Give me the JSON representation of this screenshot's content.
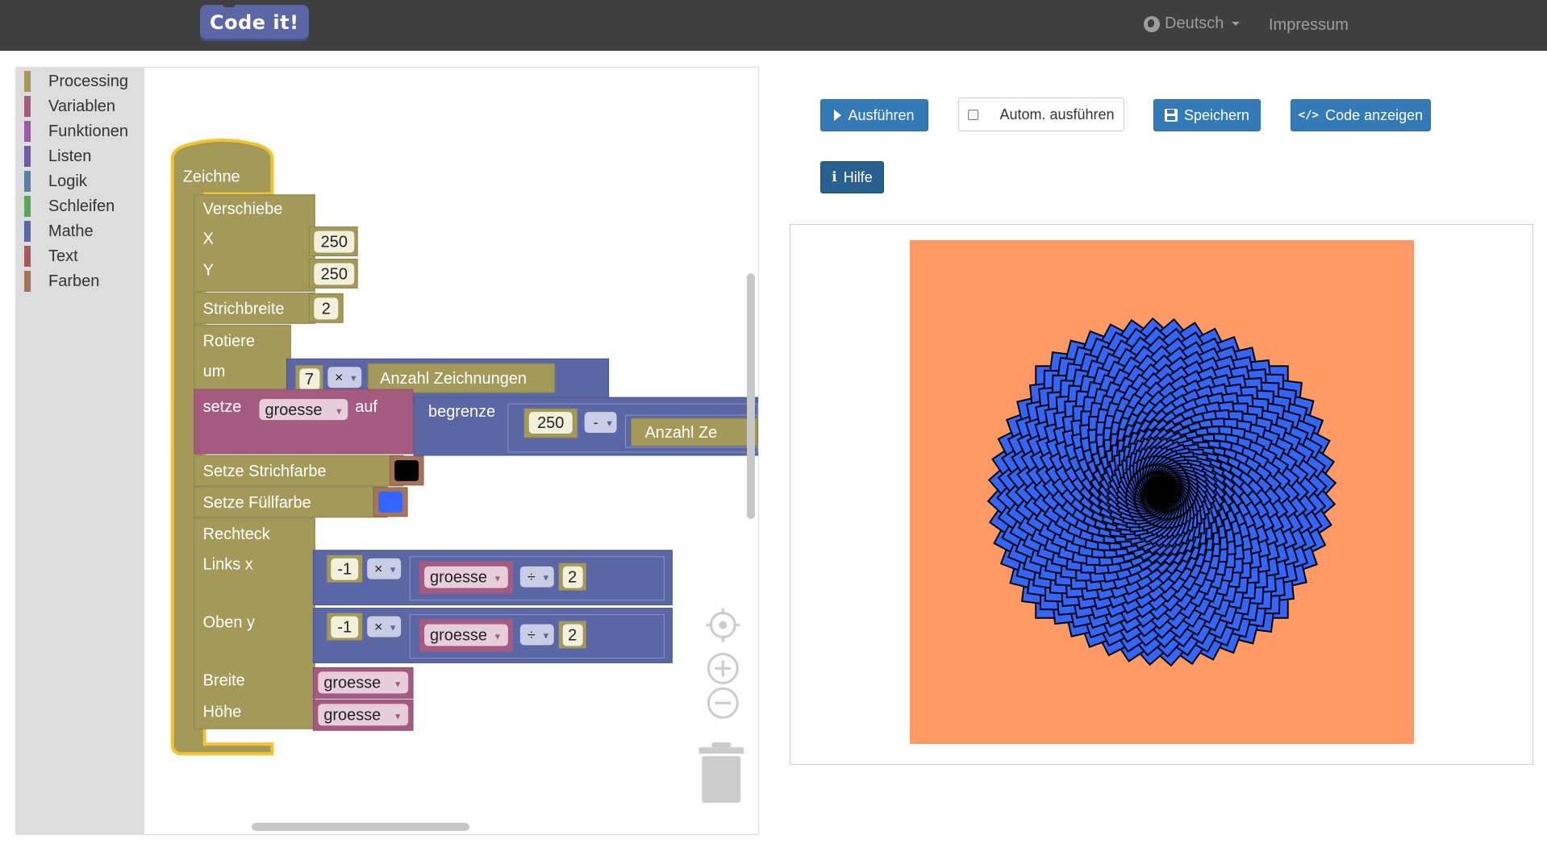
{
  "navbar": {
    "logo": "Code it!",
    "language": "Deutsch",
    "impressum": "Impressum"
  },
  "toolbox": {
    "categories": [
      {
        "label": "Processing",
        "color": "#a39a59"
      },
      {
        "label": "Variablen",
        "color": "#a55b80"
      },
      {
        "label": "Funktionen",
        "color": "#995ba5"
      },
      {
        "label": "Listen",
        "color": "#745ba5"
      },
      {
        "label": "Logik",
        "color": "#5b80a5"
      },
      {
        "label": "Schleifen",
        "color": "#5ba55b"
      },
      {
        "label": "Mathe",
        "color": "#5b67a5"
      },
      {
        "label": "Text",
        "color": "#a55b5b"
      },
      {
        "label": "Farben",
        "color": "#a5745b"
      }
    ]
  },
  "blocks": {
    "main": "Zeichne",
    "translate": {
      "label": "Verschiebe",
      "x_label": "X",
      "x_value": "250",
      "y_label": "Y",
      "y_value": "250"
    },
    "stroke_weight": {
      "label": "Strichbreite",
      "value": "2"
    },
    "rotate": {
      "label": "Rotiere",
      "um": "um",
      "factor": "7",
      "op": "×",
      "variable": "Anzahl Zeichnungen"
    },
    "set_var": {
      "label": "setze",
      "variable": "groesse",
      "auf": "auf",
      "constrain": "begrenze",
      "value": "250",
      "op": "-",
      "variable2": "Anzahl Ze"
    },
    "stroke_color": {
      "label": "Setze Strichfarbe",
      "color": "#000000"
    },
    "fill_color": {
      "label": "Setze Füllfarbe",
      "color": "#3366ff"
    },
    "rect": {
      "label": "Rechteck",
      "links_label": "Links x",
      "oben_label": "Oben y",
      "breite_label": "Breite",
      "hoehe_label": "Höhe",
      "neg": "-1",
      "mul": "×",
      "var": "groesse",
      "div": "÷",
      "two": "2"
    }
  },
  "buttons": {
    "run": "Ausführen",
    "auto_run": "Autom. ausführen",
    "save": "Speichern",
    "show_code": "Code anzeigen",
    "help": "Hilfe"
  },
  "sketch": {
    "background": "#ff9966",
    "fill": "#3366ff",
    "stroke": "#000000"
  }
}
